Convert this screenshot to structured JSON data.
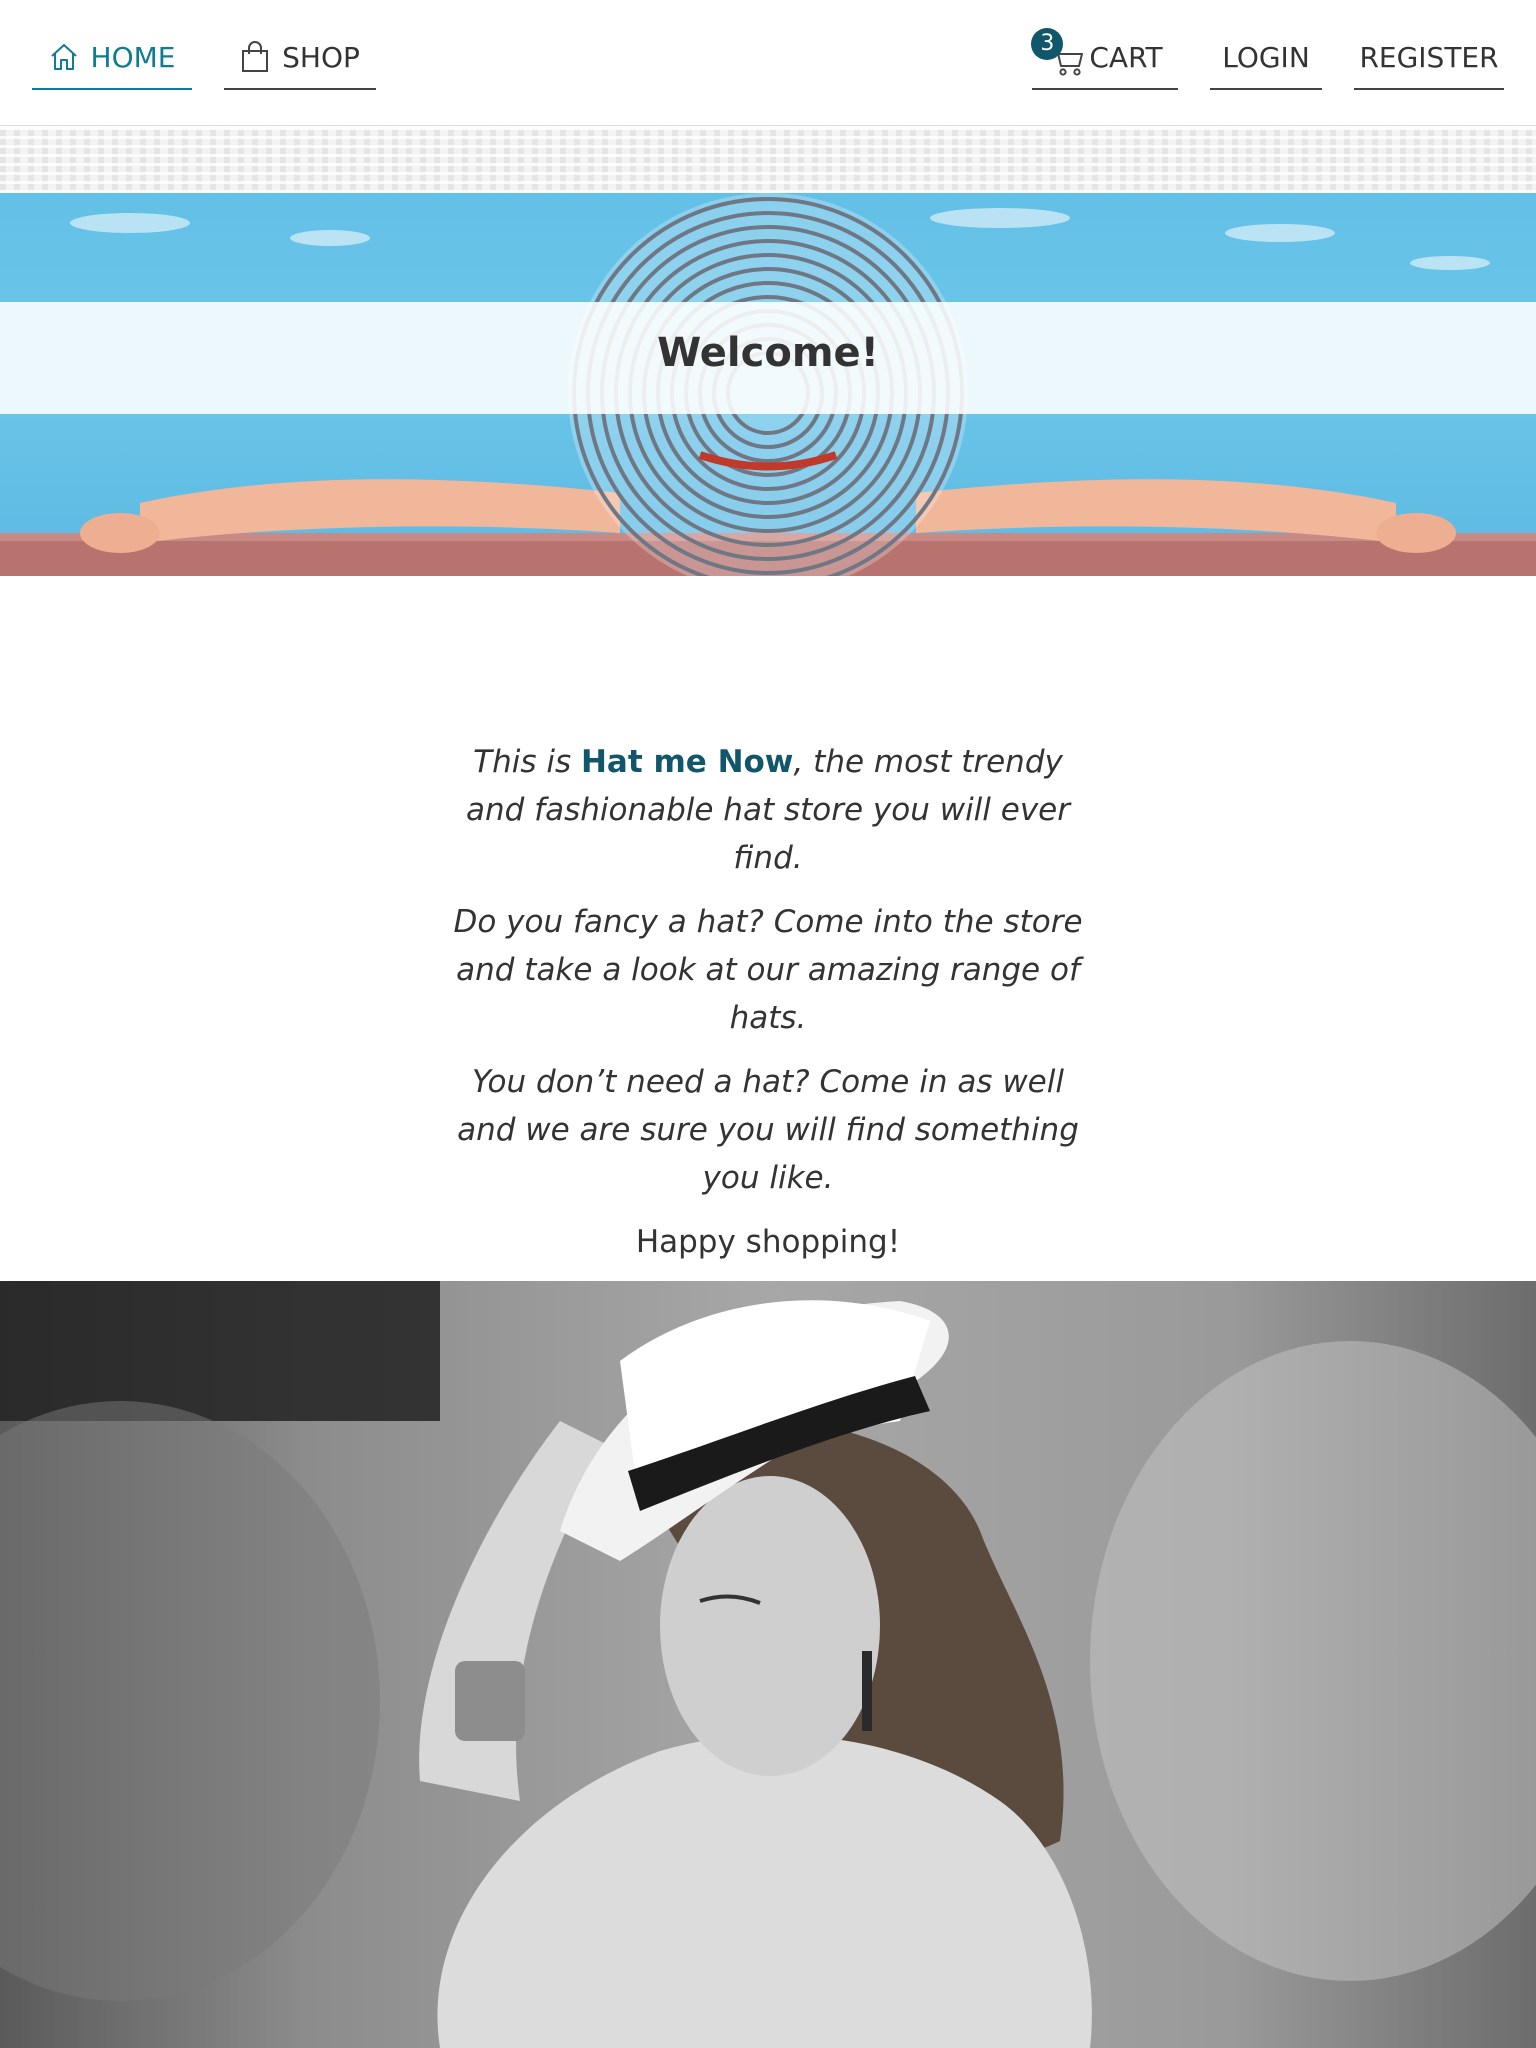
{
  "nav": {
    "home": {
      "label": "HOME",
      "icon": "home-icon",
      "active": true
    },
    "shop": {
      "label": "SHOP",
      "icon": "shopping-bag-icon"
    },
    "cart": {
      "label": "CART",
      "icon": "cart-icon",
      "count": "3"
    },
    "login": {
      "label": "LOGIN"
    },
    "register": {
      "label": "REGISTER"
    }
  },
  "hero": {
    "title": "Welcome!"
  },
  "intro": {
    "p1_pre": "This is ",
    "brand": "Hat me Now",
    "p1_post": ", the most trendy and fashionable hat store you will ever find.",
    "p2": "Do you fancy a hat? Come into the store and take a look at our amazing range of hats.",
    "p3": "You don’t need a hat? Come in as well and we are sure you will find something you like.",
    "p4": "Happy shopping!"
  },
  "colors": {
    "accent": "#0e7c93",
    "brand": "#11566b",
    "text": "#333333",
    "pool": "#63c0e6"
  }
}
